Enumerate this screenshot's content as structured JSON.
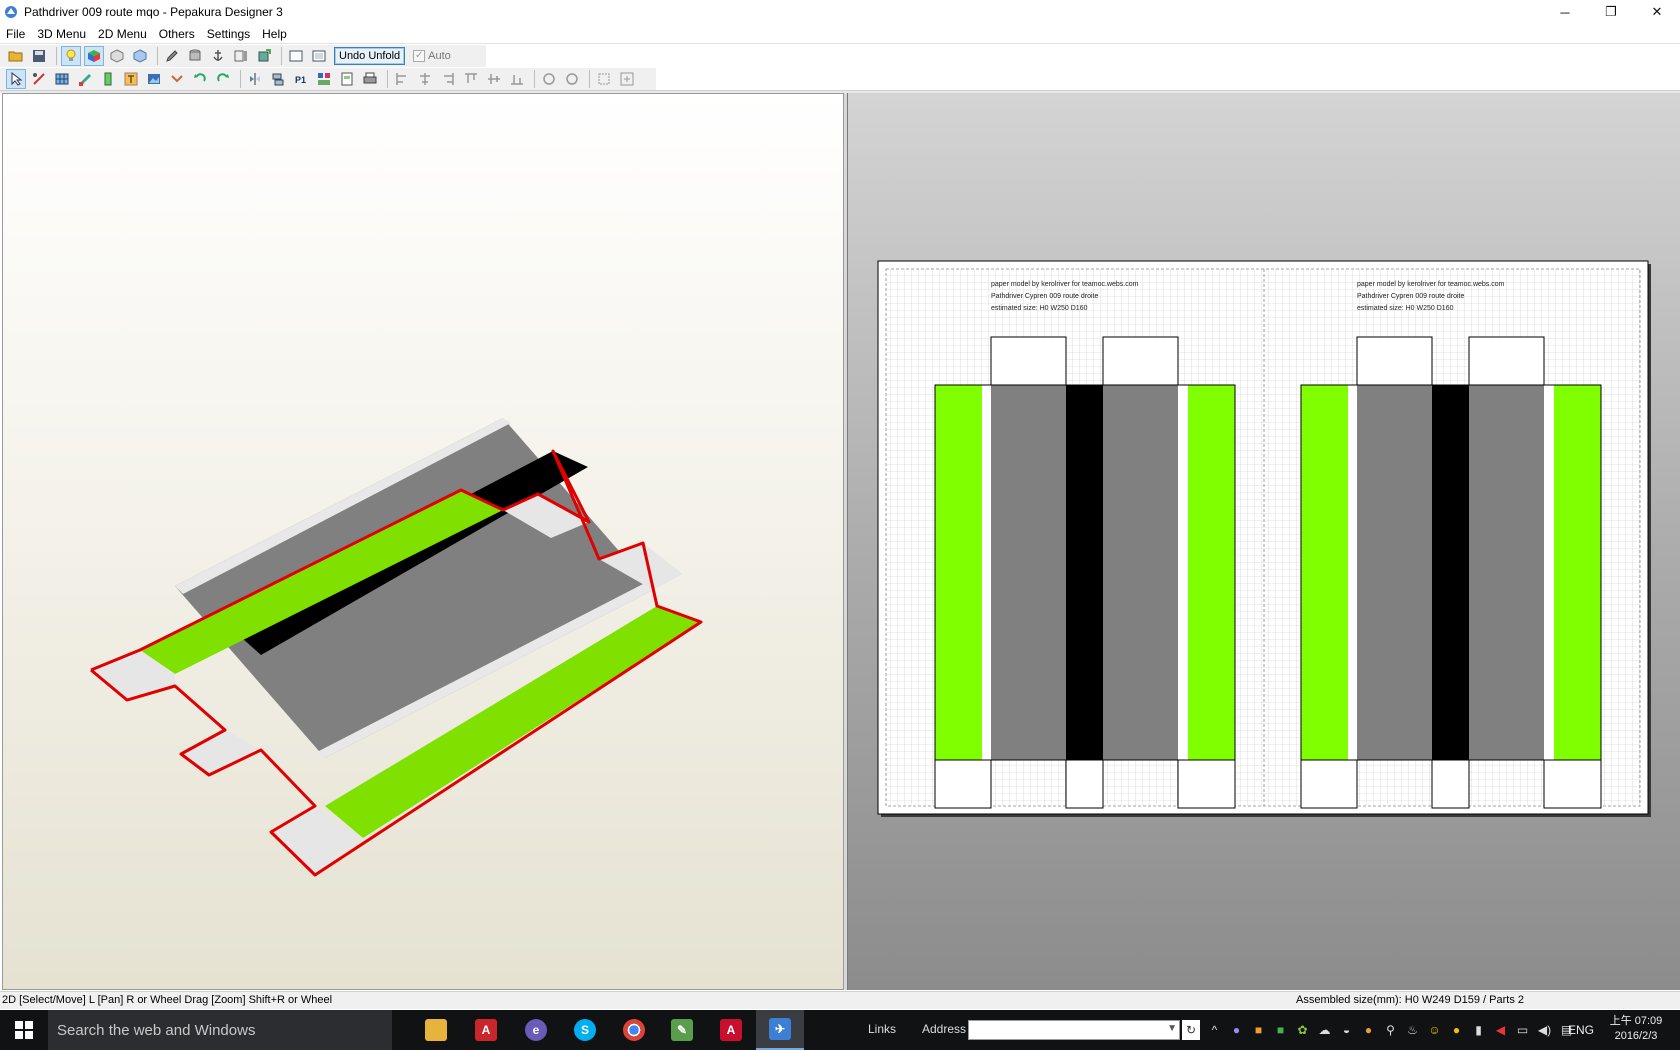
{
  "window": {
    "title": "Pathdriver 009 route mqo - Pepakura Designer 3",
    "controls": {
      "minimize": "─",
      "restore": "❐",
      "close": "✕"
    }
  },
  "menu": [
    "File",
    "3D Menu",
    "2D Menu",
    "Others",
    "Settings",
    "Help"
  ],
  "toolbar": {
    "undo_unfold_label": "Undo Unfold",
    "auto_label": "Auto",
    "auto_checked": true
  },
  "paper": {
    "pages": [
      {
        "lines": [
          "paper model by kerolriver for teamoc.webs.com",
          "Pathdriver Cypren 009 route droite",
          "estimated size: H0 W250 D160"
        ]
      },
      {
        "lines": [
          "paper model by kerolriver for teamoc.webs.com",
          "Pathdriver Cypren 009 route droite",
          "estimated size: H0 W250 D160"
        ]
      }
    ]
  },
  "colors": {
    "road_gray": "#808080",
    "center_black": "#000000",
    "grass_green": "#80ff00",
    "cut_line_red": "#e00000",
    "flap_white": "#ffffff"
  },
  "status": {
    "left": "2D [Select/Move] L [Pan] R or Wheel Drag [Zoom] Shift+R or Wheel",
    "right": "Assembled size(mm): H0 W249 D159 / Parts 2"
  },
  "taskbar": {
    "search_placeholder": "Search the web and Windows",
    "links_label": "Links",
    "address_label": "Address",
    "language": "ENG",
    "time": "上午 07:09",
    "date": "2016/2/3"
  }
}
